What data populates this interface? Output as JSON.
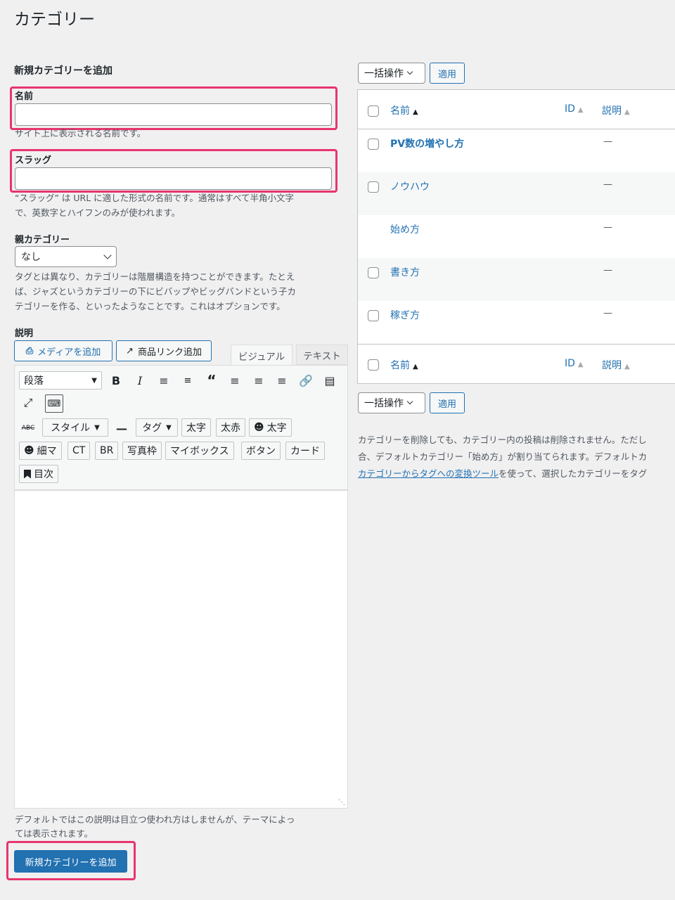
{
  "page": {
    "title": "カテゴリー"
  },
  "add_form": {
    "heading": "新規カテゴリーを追加",
    "name_label": "名前",
    "name_help": "サイト上に表示される名前です。",
    "slug_label": "スラッグ",
    "slug_help_1": "“スラッグ” は URL に適した形式の名前です。通常はすべて半角小文字",
    "slug_help_2": "で、英数字とハイフンのみが使われます。",
    "parent_label": "親カテゴリー",
    "parent_value": "なし",
    "parent_help_1": "タグとは異なり、カテゴリーは階層構造を持つことができます。たとえ",
    "parent_help_2": "ば、ジャズというカテゴリーの下にビバップやビッグバンドという子カ",
    "parent_help_3": "テゴリーを作る、といったようなことです。これはオプションです。",
    "desc_label": "説明",
    "media_button": "メディアを追加",
    "product_link_button": "商品リンク追加",
    "tab_visual": "ビジュアル",
    "tab_text": "テキスト",
    "format_select": "段落",
    "style_select": "スタイル",
    "tag_select": "タグ",
    "quicktags": [
      "太字",
      "太赤",
      "太字",
      "細マ",
      "CT",
      "BR",
      "写真枠",
      "マイボックス",
      "ボタン",
      "カード",
      "目次"
    ],
    "desc_help_1": "デフォルトではこの説明は目立つ使われ方はしませんが、テーマによっ",
    "desc_help_2": "ては表示されます。",
    "submit_button": "新規カテゴリーを追加"
  },
  "list": {
    "bulk_action": "一括操作",
    "apply_button": "適用",
    "columns": {
      "name": "名前",
      "id": "ID",
      "desc": "説明"
    },
    "rows": [
      {
        "name": "PV数の増やし方",
        "desc": "—",
        "checkbox": true,
        "bold": true
      },
      {
        "name": "ノウハウ",
        "desc": "—",
        "checkbox": true,
        "bold": false
      },
      {
        "name": "始め方",
        "desc": "—",
        "checkbox": false,
        "bold": false
      },
      {
        "name": "書き方",
        "desc": "—",
        "checkbox": true,
        "bold": false
      },
      {
        "name": "稼ぎ方",
        "desc": "—",
        "checkbox": true,
        "bold": false
      }
    ],
    "note_1": "カテゴリーを削除しても、カテゴリー内の投稿は削除されません。ただし",
    "note_2": "合、デフォルトカテゴリー「始め方」が割り当てられます。デフォルトカ",
    "note_3_link": "カテゴリーからタグへの変換ツール",
    "note_3_rest": "を使って、選択したカテゴリーをタグ"
  },
  "colors": {
    "accent": "#2271b1",
    "highlight": "#e8356d",
    "background": "#f0f0f1"
  }
}
